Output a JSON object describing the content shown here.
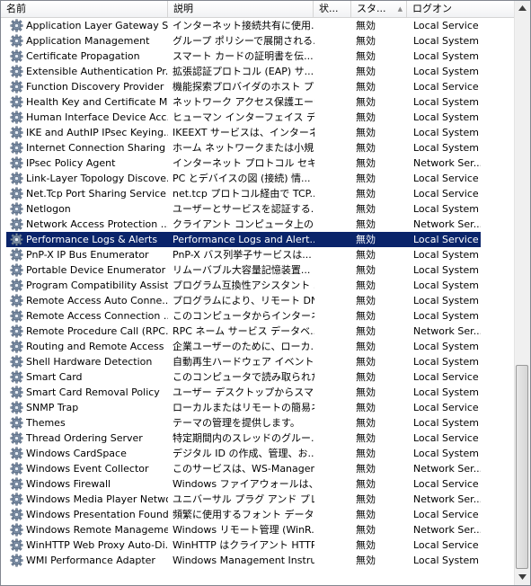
{
  "columns": {
    "name": "名前",
    "description": "説明",
    "status": "状...",
    "startup": "スタ...",
    "logon": "ログオン"
  },
  "selected_index": 14,
  "rows": [
    {
      "name": "Application Layer Gateway S...",
      "description": "インターネット接続共有に使用...",
      "startup": "無効",
      "logon": "Local Service"
    },
    {
      "name": "Application Management",
      "description": "グループ ポリシーで展開される...",
      "startup": "無効",
      "logon": "Local System"
    },
    {
      "name": "Certificate Propagation",
      "description": "スマート カードの証明書を伝...",
      "startup": "無効",
      "logon": "Local System"
    },
    {
      "name": "Extensible Authentication Pr...",
      "description": "拡張認証プロトコル (EAP) サ...",
      "startup": "無効",
      "logon": "Local System"
    },
    {
      "name": "Function Discovery Provider ...",
      "description": "機能探索プロバイダのホスト プ...",
      "startup": "無効",
      "logon": "Local Service"
    },
    {
      "name": "Health Key and Certificate M...",
      "description": "ネットワーク アクセス保護エージ...",
      "startup": "無効",
      "logon": "Local System"
    },
    {
      "name": "Human Interface Device Acc...",
      "description": "ヒューマン インターフェイス デバ...",
      "startup": "無効",
      "logon": "Local System"
    },
    {
      "name": "IKE and AuthIP IPsec Keying...",
      "description": "IKEEXT サービスは、インターネ...",
      "startup": "無効",
      "logon": "Local System"
    },
    {
      "name": "Internet Connection Sharing (...",
      "description": "ホーム ネットワークまたは小規...",
      "startup": "無効",
      "logon": "Local System"
    },
    {
      "name": "IPsec Policy Agent",
      "description": "インターネット プロトコル セキュ...",
      "startup": "無効",
      "logon": "Network Ser..."
    },
    {
      "name": "Link-Layer Topology Discove...",
      "description": "PC とデバイスの図 (接続) 情...",
      "startup": "無効",
      "logon": "Local Service"
    },
    {
      "name": "Net.Tcp Port Sharing Service",
      "description": "net.tcp プロトコル経由で TCP...",
      "startup": "無効",
      "logon": "Local Service"
    },
    {
      "name": "Netlogon",
      "description": "ユーザーとサービスを認証する...",
      "startup": "無効",
      "logon": "Local System"
    },
    {
      "name": "Network Access Protection ...",
      "description": "クライアント コンピュータ上のネ...",
      "startup": "無効",
      "logon": "Network Ser..."
    },
    {
      "name": "Performance Logs & Alerts",
      "description": "Performance Logs and Alert...",
      "startup": "無効",
      "logon": "Local Service"
    },
    {
      "name": "PnP-X IP Bus Enumerator",
      "description": "PnP-X バス列挙子サービスは...",
      "startup": "無効",
      "logon": "Local System"
    },
    {
      "name": "Portable Device Enumerator ...",
      "description": "リムーバブル大容量記憶装置...",
      "startup": "無効",
      "logon": "Local System"
    },
    {
      "name": "Program Compatibility Assist...",
      "description": "プログラム互換性アシスタント ...",
      "startup": "無効",
      "logon": "Local System"
    },
    {
      "name": "Remote Access Auto Conne...",
      "description": "プログラムにより、リモート DNS ...",
      "startup": "無効",
      "logon": "Local System"
    },
    {
      "name": "Remote Access Connection ...",
      "description": "このコンピュータからインターネッ...",
      "startup": "無効",
      "logon": "Local System"
    },
    {
      "name": "Remote Procedure Call (RPC...",
      "description": "RPC ネーム サービス データベ...",
      "startup": "無効",
      "logon": "Network Ser..."
    },
    {
      "name": "Routing and Remote Access",
      "description": "企業ユーザーのために、ローカ...",
      "startup": "無効",
      "logon": "Local System"
    },
    {
      "name": "Shell Hardware Detection",
      "description": "自動再生ハードウェア イベント...",
      "startup": "無効",
      "logon": "Local System"
    },
    {
      "name": "Smart Card",
      "description": "このコンピュータで読み取られた...",
      "startup": "無効",
      "logon": "Local Service"
    },
    {
      "name": "Smart Card Removal Policy",
      "description": "ユーザー デスクトップからスマー...",
      "startup": "無効",
      "logon": "Local System"
    },
    {
      "name": "SNMP Trap",
      "description": "ローカルまたはリモートの簡易ネ...",
      "startup": "無効",
      "logon": "Local Service"
    },
    {
      "name": "Themes",
      "description": "テーマの管理を提供します。",
      "startup": "無効",
      "logon": "Local System"
    },
    {
      "name": "Thread Ordering Server",
      "description": "特定期間内のスレッドのグルー...",
      "startup": "無効",
      "logon": "Local Service"
    },
    {
      "name": "Windows CardSpace",
      "description": "デジタル ID の作成、管理、お...",
      "startup": "無効",
      "logon": "Local System"
    },
    {
      "name": "Windows Event Collector",
      "description": "このサービスは、WS-Managem...",
      "startup": "無効",
      "logon": "Network Ser..."
    },
    {
      "name": "Windows Firewall",
      "description": "Windows ファイアウォールは、...",
      "startup": "無効",
      "logon": "Local Service"
    },
    {
      "name": "Windows Media Player Netwo...",
      "description": "ユニバーサル プラグ アンド プレ...",
      "startup": "無効",
      "logon": "Network Ser..."
    },
    {
      "name": "Windows Presentation Found...",
      "description": "頻繁に使用するフォント データ...",
      "startup": "無効",
      "logon": "Local Service"
    },
    {
      "name": "Windows Remote Manageme...",
      "description": "Windows リモート管理 (WinR...",
      "startup": "無効",
      "logon": "Network Ser..."
    },
    {
      "name": "WinHTTP Web Proxy Auto-Di...",
      "description": "WinHTTP はクライアント HTTP...",
      "startup": "無効",
      "logon": "Local Service"
    },
    {
      "name": "WMI Performance Adapter",
      "description": "Windows Management Instru...",
      "startup": "無効",
      "logon": "Local System"
    }
  ],
  "icons": {
    "row": "gear-icon",
    "scroll_up": "arrow-up-icon",
    "scroll_down": "arrow-down-icon",
    "sort": "sort-ascending-icon"
  },
  "colors": {
    "selection": "#0a246a",
    "selection_text": "#ffffff"
  }
}
